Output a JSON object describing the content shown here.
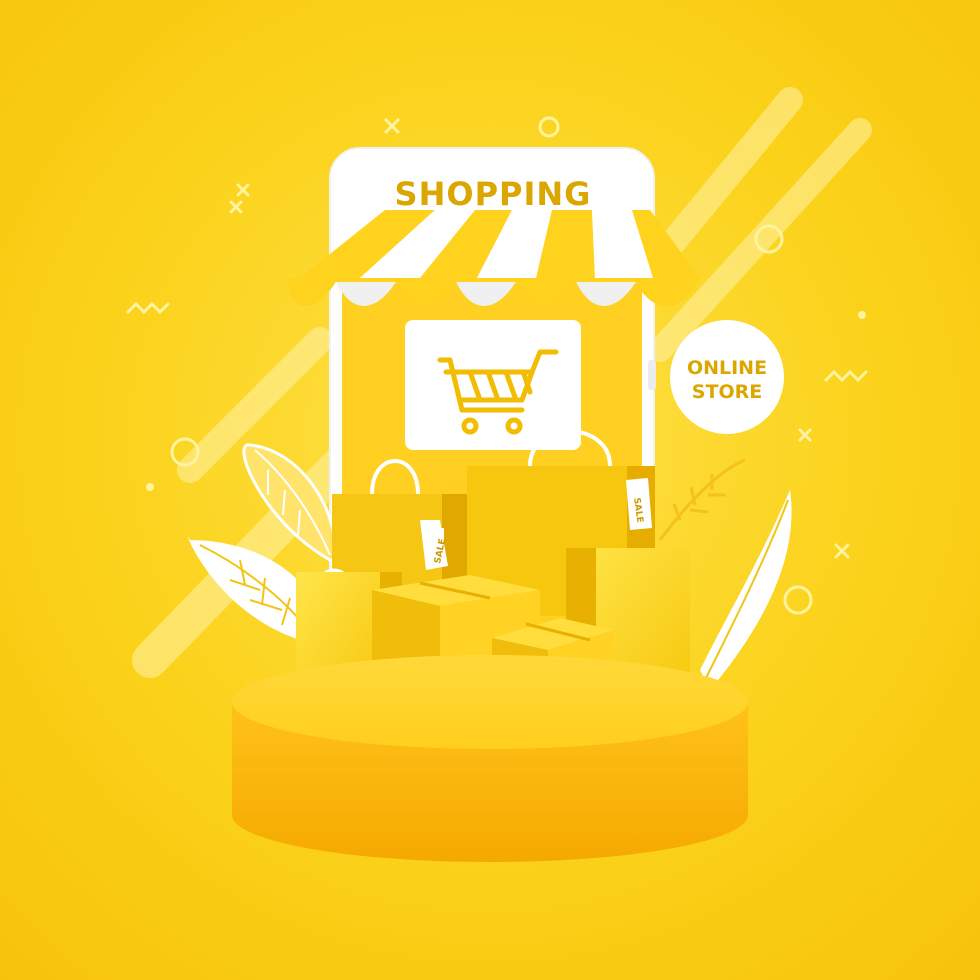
{
  "scene": {
    "title": "SHOPPING",
    "badge": {
      "line1": "ONLINE",
      "line2": "STORE"
    },
    "tags": [
      "SALE",
      "SALE"
    ]
  },
  "icons": [
    "shopping-cart-icon",
    "shopping-bag-icon",
    "cardboard-box-icon",
    "leaf-icon",
    "sale-tag-icon"
  ],
  "colors": {
    "background": "#fbd21a",
    "accent": "#f2bd00",
    "text": "#d4a000",
    "white": "#ffffff"
  }
}
